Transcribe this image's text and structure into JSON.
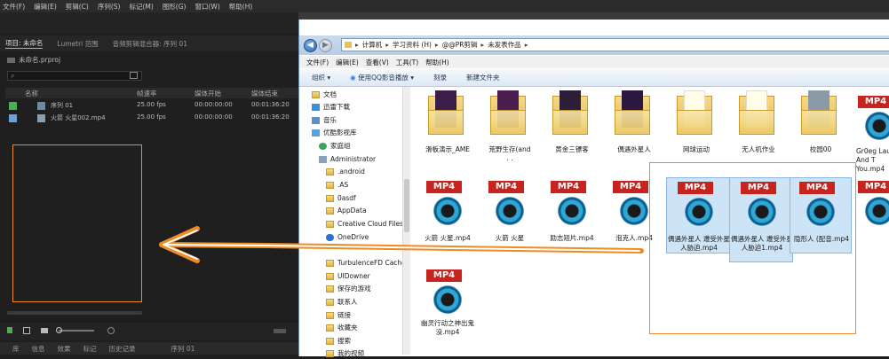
{
  "premiere": {
    "menu": [
      "文件(F)",
      "编辑(E)",
      "剪辑(C)",
      "序列(S)",
      "标记(M)",
      "图形(G)",
      "窗口(W)",
      "帮助(H)"
    ],
    "panel_tabs": [
      "项目: 未命名",
      "Lumetri 范围",
      "音频剪辑混合器: 序列 01"
    ],
    "project_name": "未命名.prproj",
    "search_icon": "magnifier-icon",
    "columns": {
      "name": "名称",
      "fps": "帧速率",
      "start": "媒体开始",
      "end": "媒体结束"
    },
    "rows": [
      {
        "name": "序列 01",
        "fps": "25.00 fps",
        "start": "00:00:00:00",
        "end": "00:01:36:20",
        "color": "#4caf50"
      },
      {
        "name": "火箭 火星002.mp4",
        "fps": "25.00 fps",
        "start": "00:00:00:00",
        "end": "00:01:36:20",
        "color": "#6aa2d8"
      }
    ],
    "bottom_tabs": [
      "库",
      "信息",
      "效果",
      "标记",
      "历史记录",
      "序列 01"
    ]
  },
  "explorer": {
    "path": [
      "计算机",
      "学习资料 (H)",
      "@@PR剪辑",
      "未发表作品"
    ],
    "menu": [
      "文件(F)",
      "编辑(E)",
      "查看(V)",
      "工具(T)",
      "帮助(H)"
    ],
    "toolbar": [
      "组织",
      "使用QQ影音播放",
      "刻录",
      "新建文件夹"
    ],
    "nav": [
      "文档",
      "迅雷下载",
      "音乐",
      "优酷影视库",
      "家庭组",
      "Administrator",
      ".android",
      ".AS",
      "0asdf",
      "AppData",
      "Creative Cloud Files",
      "OneDrive",
      "",
      "",
      "TurbulenceFD Cache",
      "UIDowner",
      "保存的游戏",
      "联系人",
      "链接",
      "收藏夹",
      "搜索",
      "我的视频"
    ],
    "folders": [
      {
        "label": "滑板演示_AME"
      },
      {
        "label": "荒野生存(and"
      },
      {
        "label": "黄金三镖客"
      },
      {
        "label": "偶遇外星人"
      },
      {
        "label": "网球运动"
      },
      {
        "label": "无人机作业"
      },
      {
        "label": "校园00"
      },
      {
        "label": "Gr0eg Lau And T You.mp4"
      }
    ],
    "mp4_badge": "MP4",
    "videos_row2": [
      {
        "label": "火箭 火星.mp4"
      },
      {
        "label": "火箭 火星"
      },
      {
        "label": "励志短片.mp4"
      },
      {
        "label": "泡克人.mp4"
      },
      {
        "label": "偶遇外星人 遭受外星人胁迫.mp4"
      },
      {
        "label": "偶遇外星人 遭受外星人胁迫1.mp4"
      },
      {
        "label": "隐形人 (配音.mp4"
      },
      {
        "label": ""
      }
    ],
    "videos_row3": [
      {
        "label": "幽灵行动之神出鬼没.mp4"
      }
    ]
  }
}
